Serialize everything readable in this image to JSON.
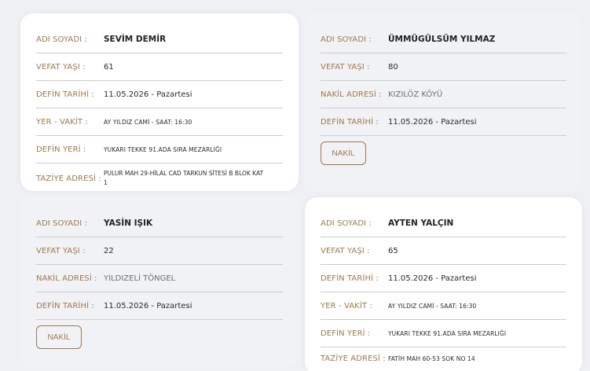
{
  "cards": [
    {
      "rows": [
        {
          "label": "ADI SOYADI :",
          "value": "SEVİM DEMİR"
        },
        {
          "label": "VEFAT YAŞI :",
          "value": "61"
        },
        {
          "label": "DEFİN TARİHİ :",
          "value": "11.05.2026 - Pazartesi"
        },
        {
          "label": "YER - VAKİT :",
          "value": "AY YILDIZ CAMİ - SAAT: 16:30"
        },
        {
          "label": "DEFİN YERİ :",
          "value": "YUKARI TEKKE 91.ADA SIRA MEZARLIĞI"
        },
        {
          "label": "TAZİYE ADRESİ :",
          "value": "PULUR MAH 29-HİLAL CAD TARKUN SİTESİ B BLOK KAT 1"
        }
      ]
    },
    {
      "rows": [
        {
          "label": "ADI SOYADI :",
          "value": "ÜMMÜGÜLSÜM YILMAZ"
        },
        {
          "label": "VEFAT YAŞI :",
          "value": "80"
        },
        {
          "label": "NAKİL ADRESİ :",
          "value": "KIZILÖZ KÖYÜ"
        },
        {
          "label": "DEFİN TARİHİ :",
          "value": "11.05.2026 - Pazartesi"
        }
      ],
      "button": "NAKİL"
    },
    {
      "rows": [
        {
          "label": "ADI SOYADI :",
          "value": "YASİN IŞIK"
        },
        {
          "label": "VEFAT YAŞI :",
          "value": "22"
        },
        {
          "label": "NAKİL ADRESİ :",
          "value": "YILDIZELİ TÖNGEL"
        },
        {
          "label": "DEFİN TARİHİ :",
          "value": "11.05.2026 - Pazartesi"
        }
      ],
      "button": "NAKİL"
    },
    {
      "rows": [
        {
          "label": "ADI SOYADI :",
          "value": "AYTEN YALÇIN"
        },
        {
          "label": "VEFAT YAŞI :",
          "value": "65"
        },
        {
          "label": "DEFİN TARİHİ :",
          "value": "11.05.2026 - Pazartesi"
        },
        {
          "label": "YER - VAKİT :",
          "value": "AY YILDIZ CAMİ - SAAT: 16:30"
        },
        {
          "label": "DEFİN YERİ :",
          "value": "YUKARI TEKKE 91.ADA SIRA MEZARLIĞI"
        },
        {
          "label": "TAZİYE ADRESİ :",
          "value": "FATİH MAH 60-53 SOK NO 14"
        }
      ]
    }
  ],
  "colors": {
    "label": "#a0784a",
    "value": "#2b2b2b",
    "divider": "#c9ccd2",
    "card_white": "#ffffff",
    "card_grey": "#f1f2f6"
  }
}
